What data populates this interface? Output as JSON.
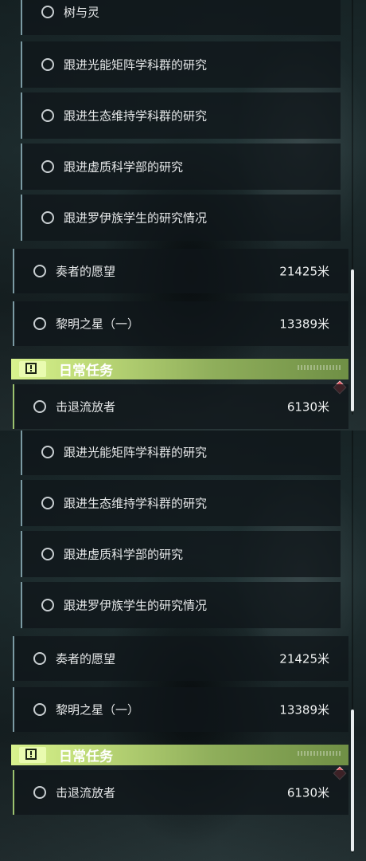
{
  "panels": [
    {
      "sub_quests": [
        {
          "label": "树与灵"
        },
        {
          "label": "跟进光能矩阵学科群的研究"
        },
        {
          "label": "跟进生态维持学科群的研究"
        },
        {
          "label": "跟进虚质科学部的研究"
        },
        {
          "label": "跟进罗伊族学生的研究情况"
        }
      ],
      "main_quests": [
        {
          "label": "奏者的愿望",
          "distance": "21425米"
        },
        {
          "label": "黎明之星（一）",
          "distance": "13389米"
        }
      ],
      "daily_section": {
        "title": "日常任务",
        "icon": "alert-square-icon"
      },
      "daily_quests": [
        {
          "label": "击退流放者",
          "distance": "6130米"
        }
      ]
    },
    {
      "sub_quests": [
        {
          "label": "跟进光能矩阵学科群的研究"
        },
        {
          "label": "跟进生态维持学科群的研究"
        },
        {
          "label": "跟进虚质科学部的研究"
        },
        {
          "label": "跟进罗伊族学生的研究情况"
        }
      ],
      "main_quests": [
        {
          "label": "奏者的愿望",
          "distance": "21425米"
        },
        {
          "label": "黎明之星（一）",
          "distance": "13389米"
        }
      ],
      "daily_section": {
        "title": "日常任务",
        "icon": "alert-square-icon"
      },
      "daily_quests": [
        {
          "label": "击退流放者",
          "distance": "6130米"
        }
      ]
    }
  ],
  "colors": {
    "accent_green": "#c4e07c",
    "quest_line": "#7b9aa3",
    "marker_red": "#d94a55"
  }
}
